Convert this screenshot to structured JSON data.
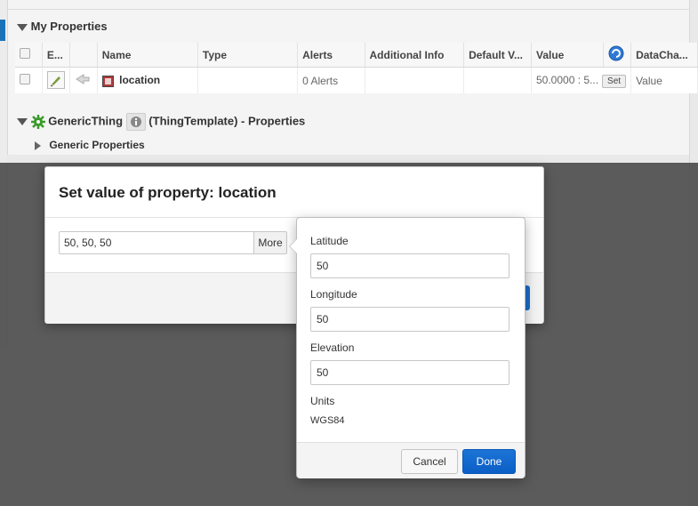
{
  "my_properties": {
    "title": "My Properties",
    "columns": [
      "E...",
      "",
      "Name",
      "Type",
      "Alerts",
      "Additional Info",
      "Default V...",
      "Value",
      "",
      "DataCha..."
    ],
    "row": {
      "name": "location",
      "type": "",
      "alerts": "0 Alerts",
      "additional_info": "",
      "default_value": "",
      "value": "50.0000 : 5...",
      "set_label": "Set",
      "data_change": "Value"
    }
  },
  "template_section": {
    "thing_name": "GenericThing",
    "suffix": "(ThingTemplate) - Properties",
    "subsection": "Generic Properties"
  },
  "dialog": {
    "title": "Set value of property: location",
    "value": "50, 50, 50",
    "more_label": "More"
  },
  "popover": {
    "latitude_label": "Latitude",
    "latitude_value": "50",
    "longitude_label": "Longitude",
    "longitude_value": "50",
    "elevation_label": "Elevation",
    "elevation_value": "50",
    "units_label": "Units",
    "units_value": "WGS84",
    "cancel_label": "Cancel",
    "done_label": "Done"
  },
  "colors": {
    "accent": "#1a73b8",
    "primary_button": "#0b5ec5",
    "overlay": "#464646"
  }
}
